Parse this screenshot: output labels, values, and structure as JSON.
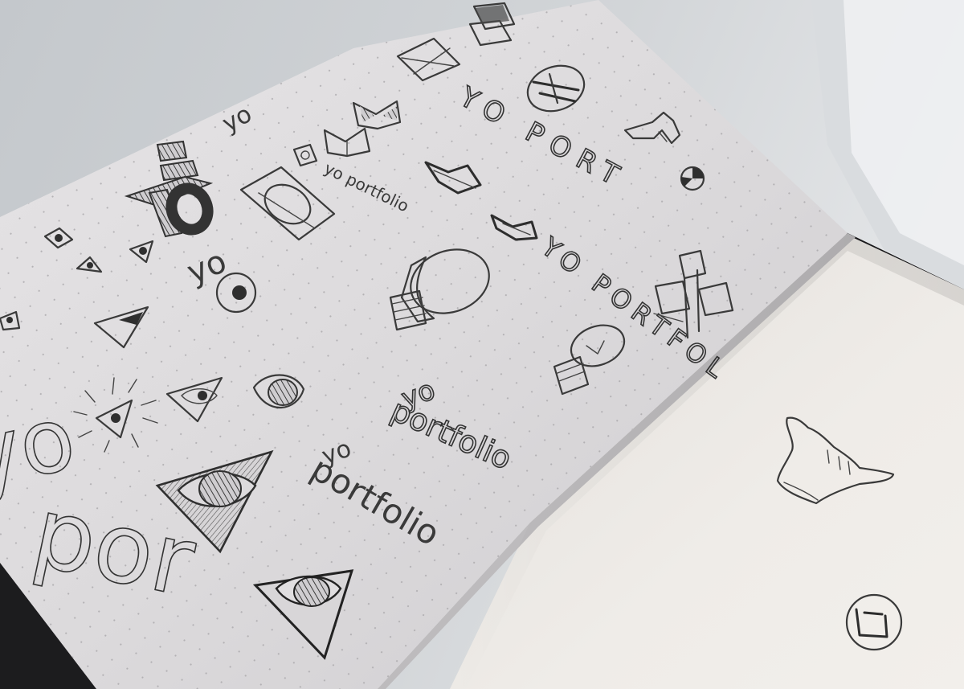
{
  "scene": {
    "colors": {
      "desk": "#c9cdd1",
      "desk_light": "#e8ebee",
      "page_left": "#dedcde",
      "page_right": "#ece9e4",
      "pencil": "#3a3a3a",
      "cover": "#1c1c1e"
    }
  },
  "sketch_text": {
    "yo_top": "yo",
    "yo_port": "YO PORT",
    "yo_portfolio_small": "yo portfolio",
    "yo_portfol": "YO PORTFOL",
    "yo_mid": "yo",
    "yo_portfolio_stack_yo": "yo",
    "yo_portfolio_stack": "portfolio",
    "yo_portfolio_large_yo": "yo",
    "yo_portfolio_large": "portfolio",
    "yo_left": "yo",
    "por_large": "por"
  },
  "icons": [
    "eye-in-triangle-icon",
    "lightbulb-icon",
    "shaka-hand-icon",
    "bow-tie-icon",
    "square-frame-icon"
  ]
}
